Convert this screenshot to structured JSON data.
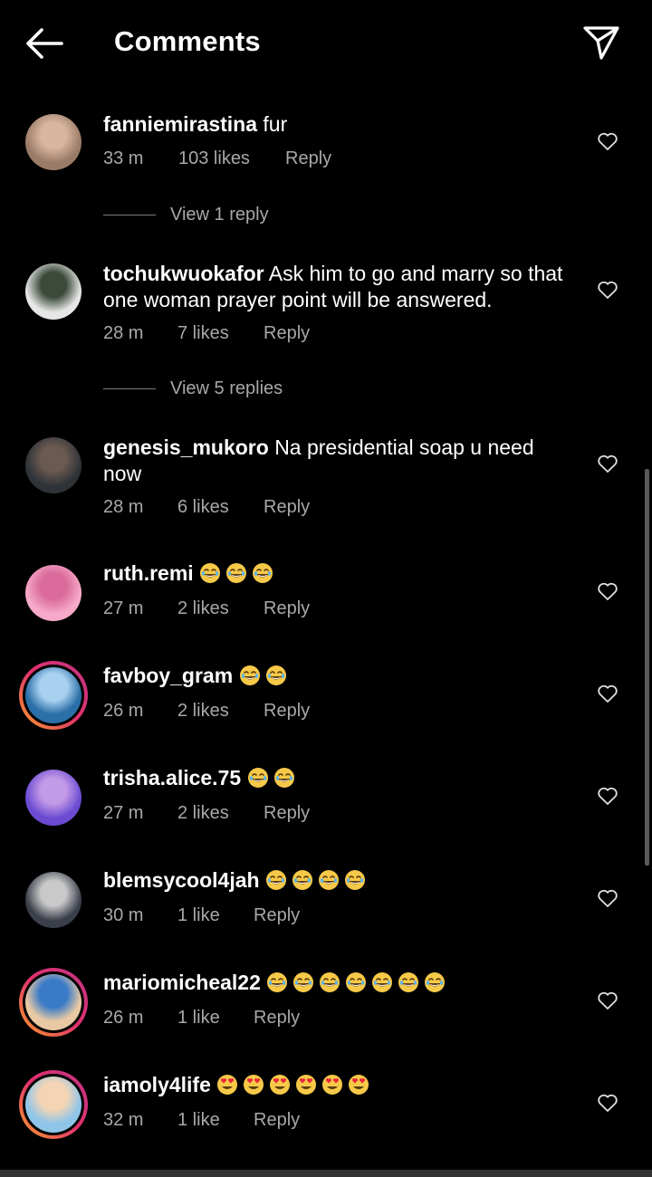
{
  "header": {
    "title": "Comments"
  },
  "comments": [
    {
      "user": "fanniemirastina",
      "text": "fur",
      "time": "33 m",
      "likes": "103 likes",
      "reply": "Reply",
      "emoji": [],
      "view_replies": "View 1 reply",
      "ring": false
    },
    {
      "user": "tochukwuokafor",
      "text": "Ask him to go and marry so that one woman prayer point will be answered.",
      "time": "28 m",
      "likes": "7 likes",
      "reply": "Reply",
      "emoji": [],
      "view_replies": "View 5 replies",
      "ring": false
    },
    {
      "user": "genesis_mukoro",
      "text": "Na presidential soap u need now",
      "time": "28 m",
      "likes": "6 likes",
      "reply": "Reply",
      "emoji": [],
      "ring": false
    },
    {
      "user": "ruth.remi",
      "text": "",
      "time": "27 m",
      "likes": "2 likes",
      "reply": "Reply",
      "emoji": [
        "joy-emoji",
        "joy-emoji",
        "joy-emoji"
      ],
      "ring": false
    },
    {
      "user": "favboy_gram",
      "text": "",
      "time": "26 m",
      "likes": "2 likes",
      "reply": "Reply",
      "emoji": [
        "joy-emoji",
        "joy-emoji"
      ],
      "ring": true
    },
    {
      "user": "trisha.alice.75",
      "text": "",
      "time": "27 m",
      "likes": "2 likes",
      "reply": "Reply",
      "emoji": [
        "joy-emoji",
        "joy-emoji"
      ],
      "ring": false
    },
    {
      "user": "blemsycool4jah",
      "text": "",
      "time": "30 m",
      "likes": "1 like",
      "reply": "Reply",
      "emoji": [
        "joy-emoji",
        "joy-emoji",
        "joy-emoji",
        "joy-emoji"
      ],
      "ring": false
    },
    {
      "user": "mariomicheal22",
      "text": "",
      "time": "26 m",
      "likes": "1 like",
      "reply": "Reply",
      "emoji": [
        "joy-emoji",
        "joy-emoji",
        "joy-emoji",
        "joy-emoji",
        "joy-emoji",
        "joy-emoji",
        "joy-emoji"
      ],
      "ring": true
    },
    {
      "user": "iamoly4life",
      "text": "",
      "time": "32 m",
      "likes": "1 like",
      "reply": "Reply",
      "emoji": [
        "heart-eyes-emoji",
        "heart-eyes-emoji",
        "heart-eyes-emoji",
        "heart-eyes-emoji",
        "heart-eyes-emoji",
        "heart-eyes-emoji"
      ],
      "ring": true
    }
  ]
}
